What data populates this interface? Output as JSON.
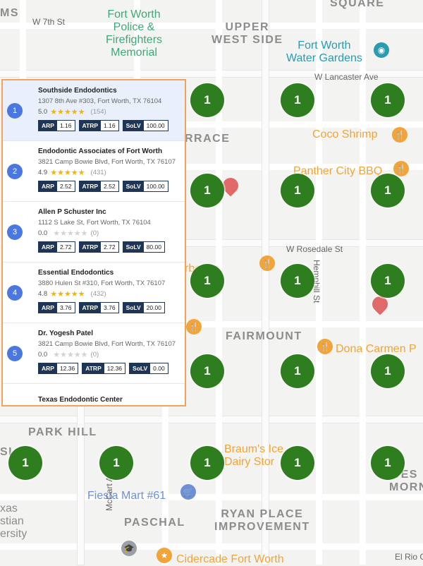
{
  "map": {
    "labels": {
      "square": "SQUARE",
      "ms": "MS",
      "w7th": "W 7th St",
      "upper_west_side": "UPPER\nWEST SIDE",
      "fort_worth_police": "Fort Worth\nPolice &\nFirefighters\nMemorial",
      "water_gardens": "Fort Worth\nWater Gardens",
      "lancaster": "W Lancaster Ave",
      "rrace": "RRACE",
      "coco_shrimp": "Coco Shrimp",
      "panther_city": "Panther City BBQ",
      "rosedale": "W Rosedale St",
      "hemphill": "Hemphill St",
      "rbecue": "rbecue",
      "fairmount": "FAIRMOUNT",
      "dona_carmen": "Dona Carmen P",
      "park_hill": "PARK HILL",
      "braums": "Braum's Ice\nDairy Stor",
      "fiesta": "Fiesta Mart #61",
      "mccart": "McCart Ave",
      "paschal": "PASCHAL",
      "ryan_place": "RYAN PLACE\nIMPROVEMENT",
      "cidercade": "Cidercade Fort Worth",
      "el_rio": "El Rio Gr",
      "wes_morning": "WES\nMORNIN",
      "texas_univ": "xas\nstian\nersity",
      "si": "SI"
    },
    "grid_markers": [
      "1",
      "1",
      "1",
      "1",
      "1",
      "1",
      "1",
      "1",
      "1",
      "1",
      "1",
      "1",
      "1",
      "1",
      "1",
      "1",
      "1",
      "1",
      "1"
    ]
  },
  "panel": {
    "results": [
      {
        "rank": "1",
        "name": "Southside Endodontics",
        "address": "1307 8th Ave #303, Fort Worth, TX 76104",
        "rating": "5.0",
        "stars": "★★★★★",
        "empty_stars": "",
        "reviews": "(154)",
        "arp_label": "ARP",
        "arp": "1.16",
        "atrp_label": "ATRP",
        "atrp": "1.16",
        "solv_label": "SoLV",
        "solv": "100.00"
      },
      {
        "rank": "2",
        "name": "Endodontic Associates of Fort Worth",
        "address": "3821 Camp Bowie Blvd, Fort Worth, TX 76107",
        "rating": "4.9",
        "stars": "★★★★★",
        "empty_stars": "",
        "reviews": "(431)",
        "arp_label": "ARP",
        "arp": "2.52",
        "atrp_label": "ATRP",
        "atrp": "2.52",
        "solv_label": "SoLV",
        "solv": "100.00"
      },
      {
        "rank": "3",
        "name": "Allen P Schuster Inc",
        "address": "1112 S Lake St, Fort Worth, TX 76104",
        "rating": "0.0",
        "stars": "",
        "empty_stars": "★★★★★",
        "reviews": "(0)",
        "arp_label": "ARP",
        "arp": "2.72",
        "atrp_label": "ATRP",
        "atrp": "2.72",
        "solv_label": "SoLV",
        "solv": "80.00"
      },
      {
        "rank": "4",
        "name": "Essential Endodontics",
        "address": "3880 Hulen St #310, Fort Worth, TX 76107",
        "rating": "4.8",
        "stars": "★★★★★",
        "empty_stars": "",
        "reviews": "(432)",
        "arp_label": "ARP",
        "arp": "3.76",
        "atrp_label": "ATRP",
        "atrp": "3.76",
        "solv_label": "SoLV",
        "solv": "20.00"
      },
      {
        "rank": "5",
        "name": "Dr. Yogesh Patel",
        "address": "3821 Camp Bowie Blvd, Fort Worth, TX 76107",
        "rating": "0.0",
        "stars": "",
        "empty_stars": "★★★★★",
        "reviews": "(0)",
        "arp_label": "ARP",
        "arp": "12.36",
        "atrp_label": "ATRP",
        "atrp": "12.36",
        "solv_label": "SoLV",
        "solv": "0.00"
      }
    ],
    "partial_result_name": "Texas Endodontic Center"
  }
}
